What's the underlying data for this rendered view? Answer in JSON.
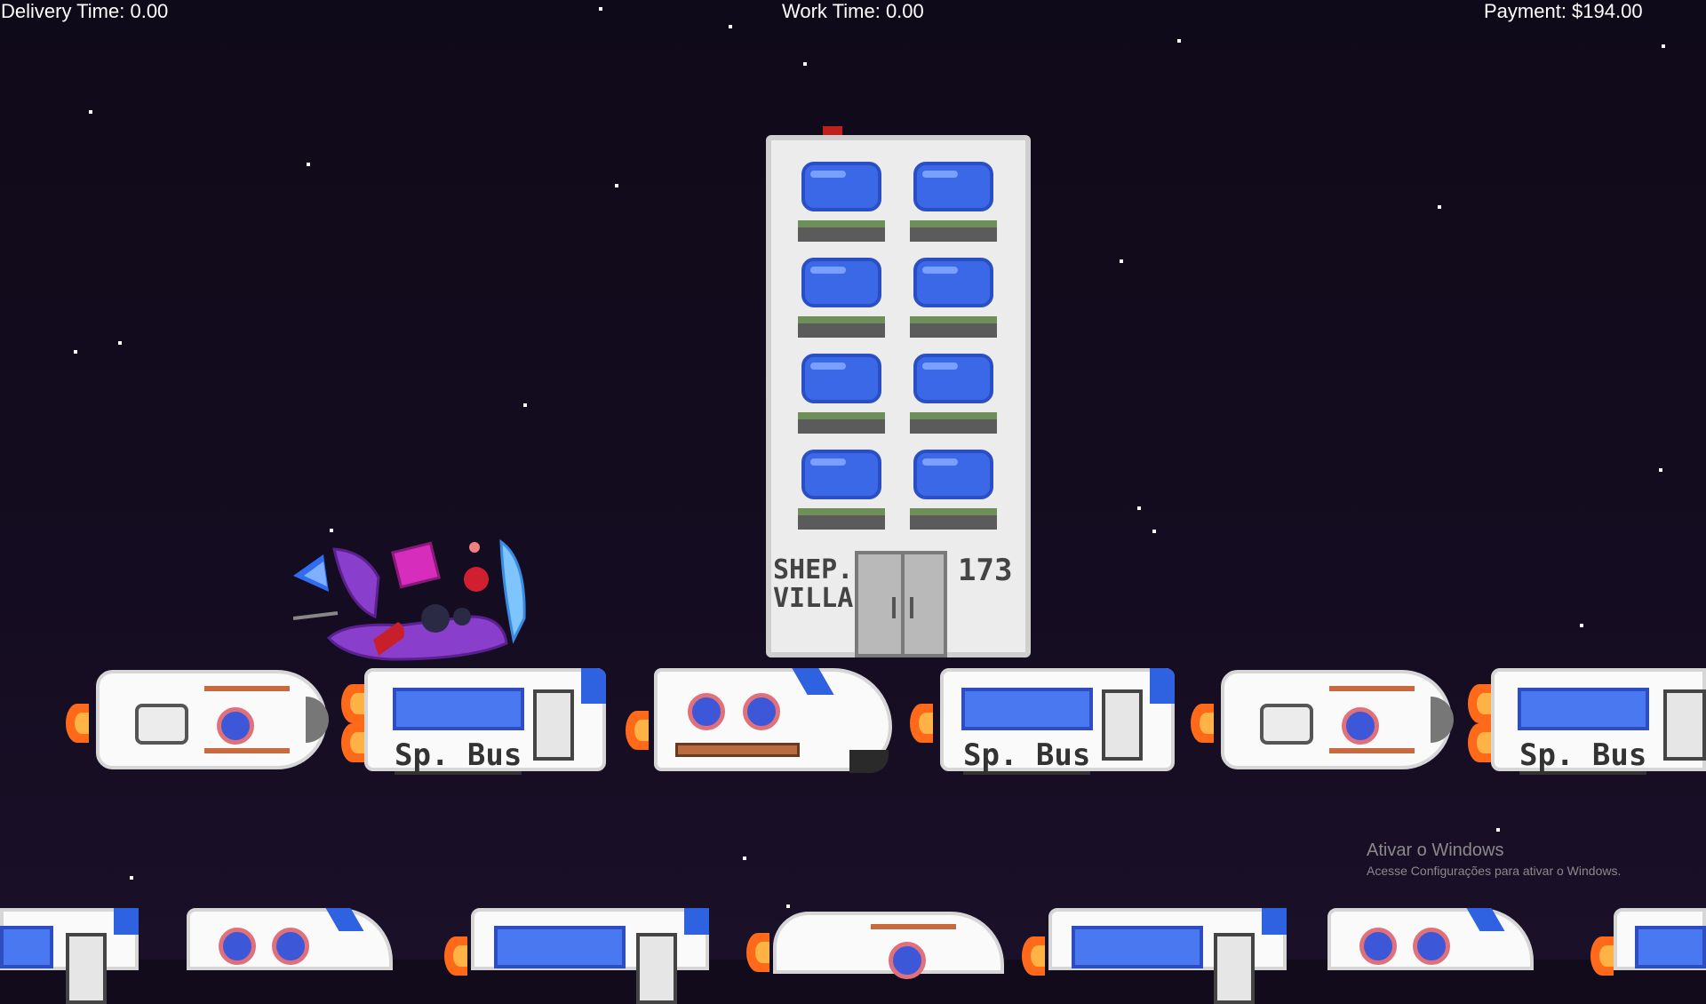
{
  "hud": {
    "delivery_time": "Delivery Time: 0.00",
    "work_time": "Work Time: 0.00",
    "payment": "Payment: $194.00"
  },
  "building": {
    "name_line1": "SHEP.",
    "name_line2": "VILLA",
    "number": "173"
  },
  "vehicles": {
    "bus_label": "Sp. Bus"
  },
  "windows_activation": {
    "title": "Ativar o Windows",
    "subtitle": "Acesse Configurações para ativar o Windows."
  },
  "colors": {
    "sky": "#120b1c",
    "window_blue": "#3b68e6",
    "player_purple": "#8a3fcc",
    "flame_orange": "#ff6a1a"
  }
}
